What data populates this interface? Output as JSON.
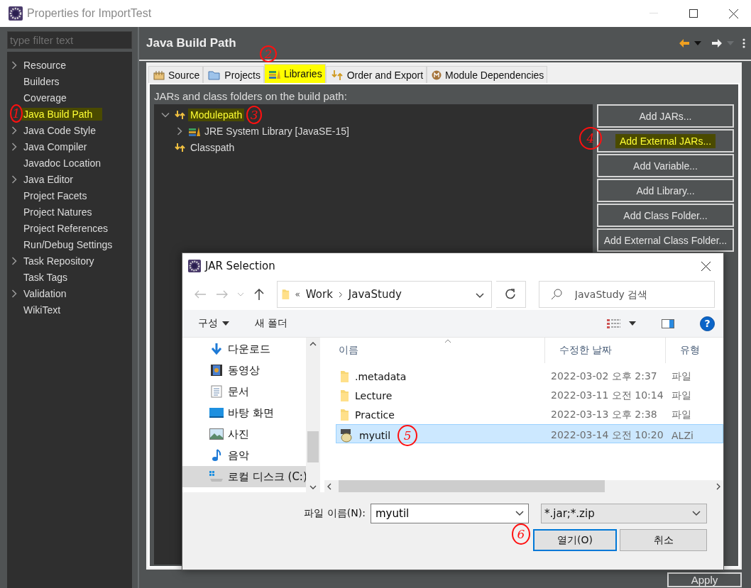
{
  "window": {
    "title": "Properties for ImportTest"
  },
  "filter": {
    "placeholder": "type filter text"
  },
  "sidebar": {
    "items": [
      {
        "label": "Resource",
        "expandable": true,
        "highlighted": false
      },
      {
        "label": "Builders",
        "expandable": false,
        "highlighted": false
      },
      {
        "label": "Coverage",
        "expandable": false,
        "highlighted": false
      },
      {
        "label": "Java Build Path",
        "expandable": false,
        "highlighted": true,
        "annotation": "1"
      },
      {
        "label": "Java Code Style",
        "expandable": true,
        "highlighted": false
      },
      {
        "label": "Java Compiler",
        "expandable": true,
        "highlighted": false
      },
      {
        "label": "Javadoc Location",
        "expandable": false,
        "highlighted": false
      },
      {
        "label": "Java Editor",
        "expandable": true,
        "highlighted": false
      },
      {
        "label": "Project Facets",
        "expandable": false,
        "highlighted": false
      },
      {
        "label": "Project Natures",
        "expandable": false,
        "highlighted": false
      },
      {
        "label": "Project References",
        "expandable": false,
        "highlighted": false
      },
      {
        "label": "Run/Debug Settings",
        "expandable": false,
        "highlighted": false
      },
      {
        "label": "Task Repository",
        "expandable": true,
        "highlighted": false
      },
      {
        "label": "Task Tags",
        "expandable": false,
        "highlighted": false
      },
      {
        "label": "Validation",
        "expandable": true,
        "highlighted": false
      },
      {
        "label": "WikiText",
        "expandable": false,
        "highlighted": false
      }
    ]
  },
  "page": {
    "title": "Java Build Path"
  },
  "tabs": [
    {
      "label": "Source",
      "kind": "source",
      "selected": false,
      "highlighted": false
    },
    {
      "label": "Projects",
      "kind": "projects",
      "selected": false,
      "highlighted": false
    },
    {
      "label": "Libraries",
      "kind": "libraries",
      "selected": true,
      "highlighted": true,
      "annotation": "2"
    },
    {
      "label": "Order and Export",
      "kind": "order",
      "selected": false,
      "highlighted": false
    },
    {
      "label": "Module Dependencies",
      "kind": "module",
      "selected": false,
      "highlighted": false
    }
  ],
  "libraries": {
    "caption": "JARs and class folders on the build path:",
    "tree": [
      {
        "label": "Modulepath",
        "kind": "path",
        "expandable": true,
        "expanded": true,
        "highlighted": true,
        "annotation": "3",
        "children": [
          {
            "label": "JRE System Library [JavaSE-15]",
            "kind": "library",
            "expandable": true,
            "expanded": false,
            "highlighted": false
          }
        ]
      },
      {
        "label": "Classpath",
        "kind": "path",
        "expandable": false,
        "highlighted": false
      }
    ]
  },
  "buttons": [
    {
      "label": "Add JARs...",
      "highlighted": false
    },
    {
      "label": "Add External JARs...",
      "highlighted": true,
      "annotation": "4"
    },
    {
      "label": "Add Variable...",
      "highlighted": false
    },
    {
      "label": "Add Library...",
      "highlighted": false
    },
    {
      "label": "Add Class Folder...",
      "highlighted": false
    },
    {
      "label": "Add External Class Folder...",
      "highlighted": false
    }
  ],
  "apply": "Apply",
  "dialog": {
    "title": "JAR Selection",
    "address_overflow": "«",
    "address": [
      "Work",
      "JavaStudy"
    ],
    "search": {
      "placeholder": "JavaStudy 검색"
    },
    "organize": "구성",
    "new_folder": "새 폴더",
    "help": "?",
    "nav": [
      {
        "label": "다운로드",
        "kind": "download",
        "selected": false
      },
      {
        "label": "동영상",
        "kind": "video",
        "selected": false
      },
      {
        "label": "문서",
        "kind": "document",
        "selected": false
      },
      {
        "label": "바탕 화면",
        "kind": "desktop",
        "selected": false
      },
      {
        "label": "사진",
        "kind": "picture",
        "selected": false
      },
      {
        "label": "음악",
        "kind": "music",
        "selected": false
      },
      {
        "label": "로컬 디스크 (C:)",
        "kind": "drive",
        "selected": true
      }
    ],
    "columns": [
      "이름",
      "수정한 날짜",
      "유형"
    ],
    "files": [
      {
        "name": ".metadata",
        "date": "2022-03-02 오후 2:37",
        "type": "파일",
        "kind": "folder",
        "selected": false
      },
      {
        "name": "Lecture",
        "date": "2022-03-11 오전 10:14",
        "type": "파일",
        "kind": "folder",
        "selected": false
      },
      {
        "name": "Practice",
        "date": "2022-03-13 오후 2:38",
        "type": "파일",
        "kind": "folder",
        "selected": false
      },
      {
        "name": "myutil",
        "date": "2022-03-14 오전 10:20",
        "type": "ALZi",
        "kind": "jar",
        "selected": true,
        "annotation": "5"
      }
    ],
    "filename": {
      "label": "파일 이름(N):",
      "value": "myutil"
    },
    "filetype": "*.jar;*.zip",
    "buttons": [
      {
        "label": "열기(O)",
        "default": true,
        "annotation": "6"
      },
      {
        "label": "취소",
        "default": false
      }
    ]
  }
}
